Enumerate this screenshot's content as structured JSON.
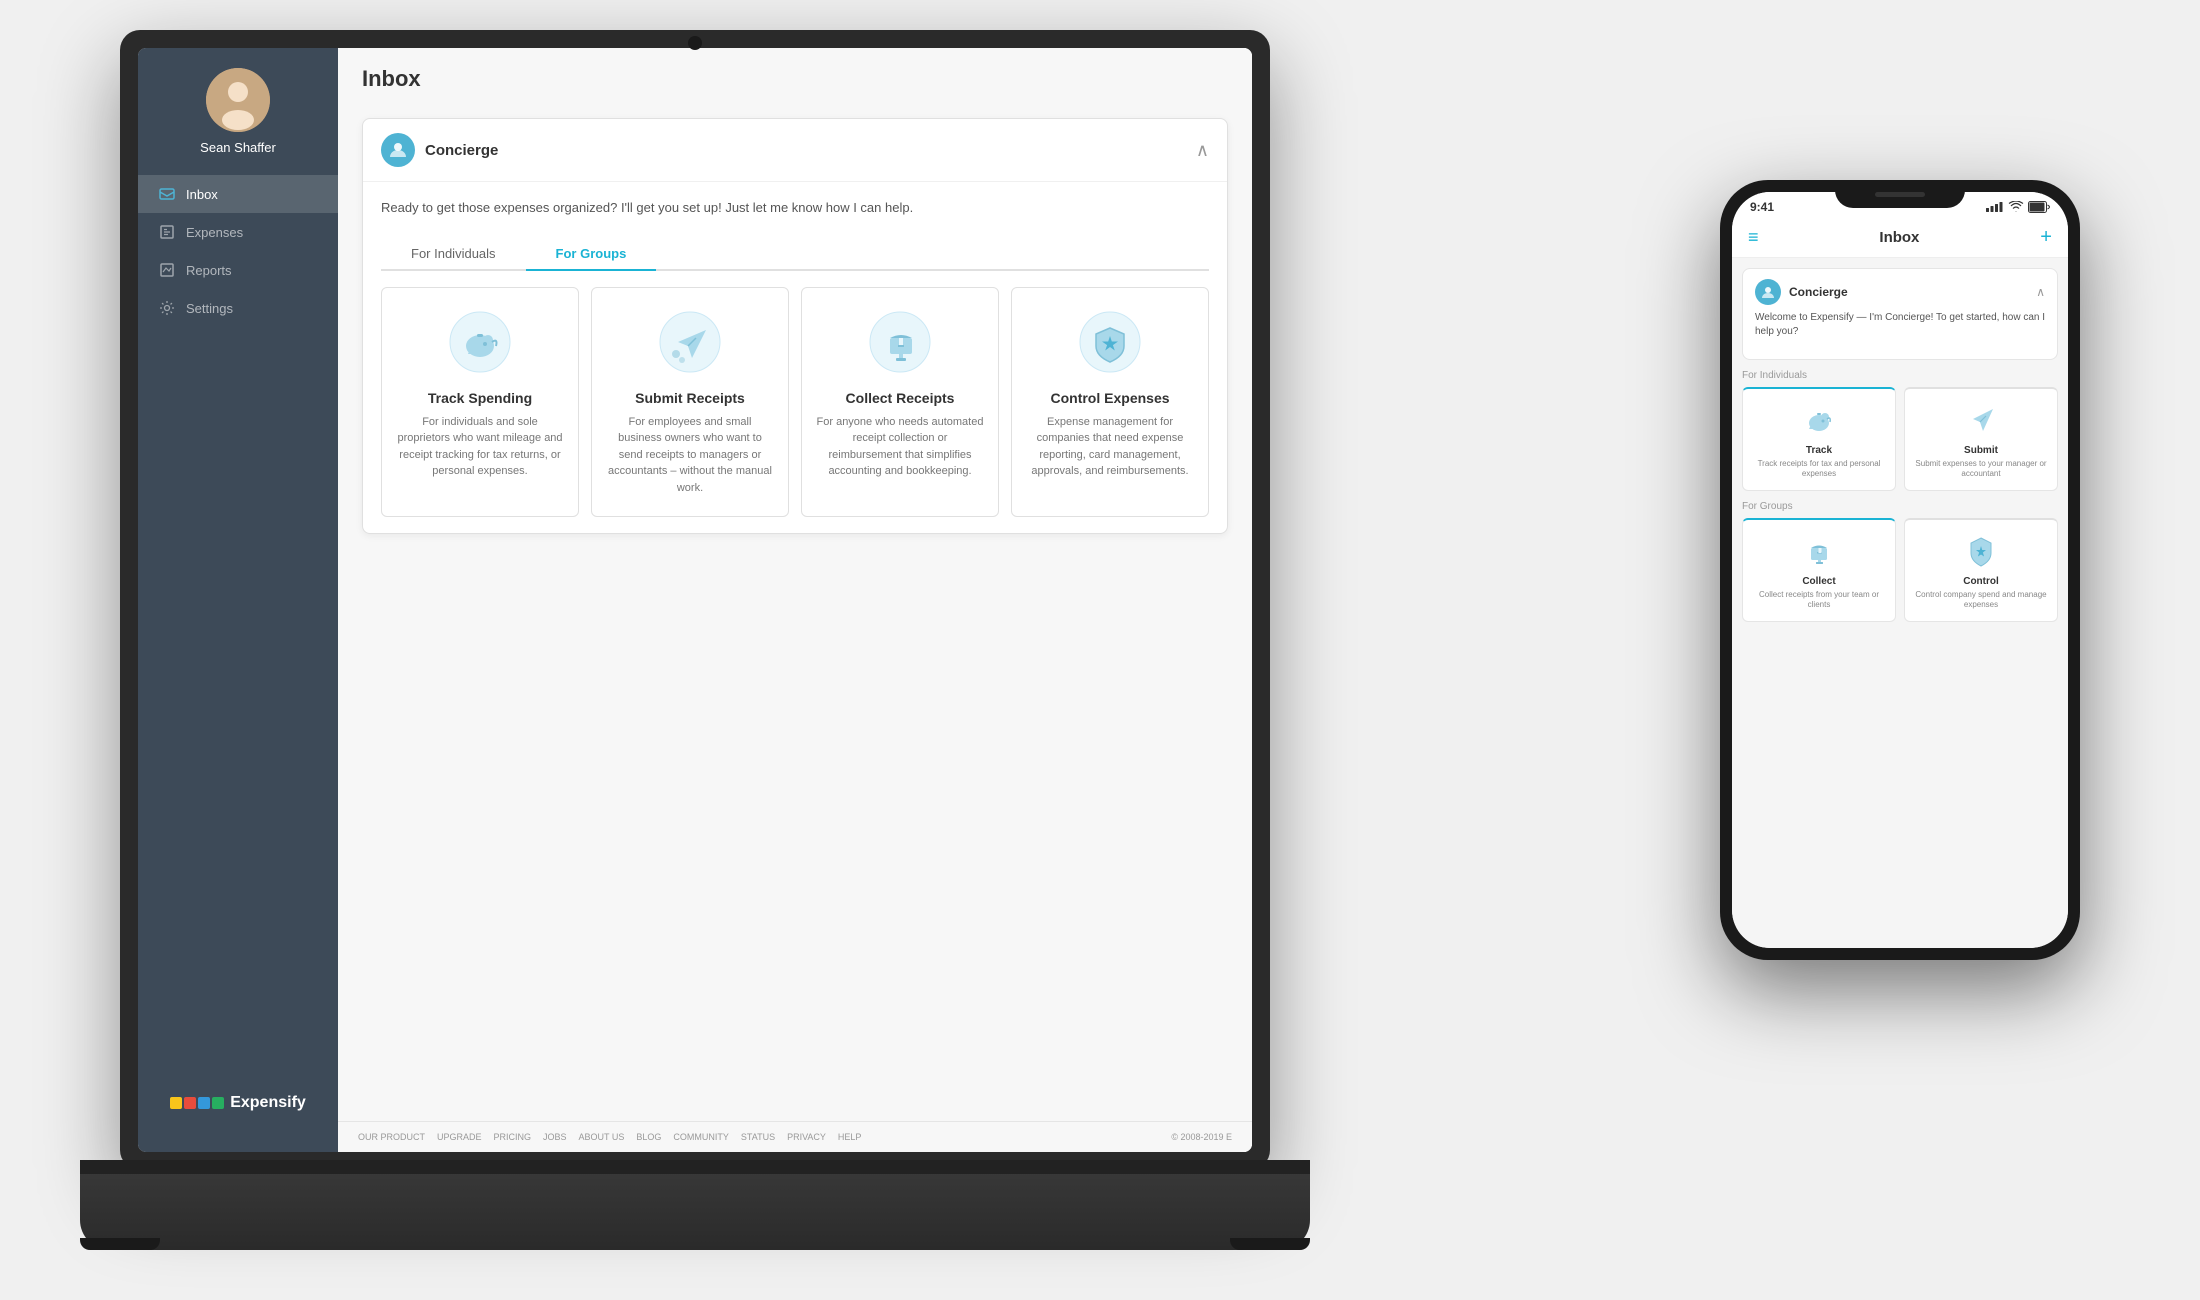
{
  "laptop": {
    "sidebar": {
      "user_name": "Sean Shaffer",
      "nav_items": [
        {
          "label": "Inbox",
          "active": true
        },
        {
          "label": "Expenses",
          "active": false
        },
        {
          "label": "Reports",
          "active": false
        },
        {
          "label": "Settings",
          "active": false
        }
      ],
      "logo_text": "Expensify"
    },
    "main": {
      "page_title": "Inbox",
      "concierge": {
        "name": "Concierge",
        "message": "Ready to get those expenses organized? I'll get you set up! Just let me know how I can help."
      },
      "tabs": [
        {
          "label": "For Individuals",
          "active": false
        },
        {
          "label": "For Groups",
          "active": true
        }
      ],
      "options": [
        {
          "title": "Track Spending",
          "desc": "For individuals and sole proprietors who want mileage and receipt tracking for tax returns, or personal expenses."
        },
        {
          "title": "Submit Receipts",
          "desc": "For employees and small business owners who want to send receipts to managers or accountants – without the manual work."
        },
        {
          "title": "Collect Receipts",
          "desc": "For anyone who needs automated receipt collection or reimbursement that simplifies accounting and bookkeeping."
        },
        {
          "title": "Control Expenses",
          "desc": "Expense management for companies that need expense reporting, card management, approvals, and reimbursements."
        }
      ]
    },
    "footer": {
      "links": [
        "OUR PRODUCT",
        "UPGRADE",
        "PRICING",
        "JOBS",
        "ABOUT US",
        "BLOG",
        "COMMUNITY",
        "STATUS",
        "PRIVACY",
        "HELP"
      ],
      "copyright": "© 2008-2019 E"
    }
  },
  "phone": {
    "status_bar": {
      "time": "9:41",
      "signal": "▌▌▌",
      "wifi": "WiFi",
      "battery": "■"
    },
    "nav": {
      "title": "Inbox",
      "plus": "+"
    },
    "concierge": {
      "name": "Concierge",
      "message": "Welcome to Expensify — I'm Concierge! To get started, how can I help you?"
    },
    "sections": [
      {
        "label": "For Individuals",
        "cards": [
          {
            "title": "Track",
            "desc": "Track receipts for tax and personal expenses"
          },
          {
            "title": "Submit",
            "desc": "Submit expenses to your manager or accountant"
          }
        ]
      },
      {
        "label": "For Groups",
        "cards": [
          {
            "title": "Collect",
            "desc": "Collect receipts from your team or clients"
          },
          {
            "title": "Control",
            "desc": "Control company spend and manage expenses"
          }
        ]
      }
    ]
  }
}
